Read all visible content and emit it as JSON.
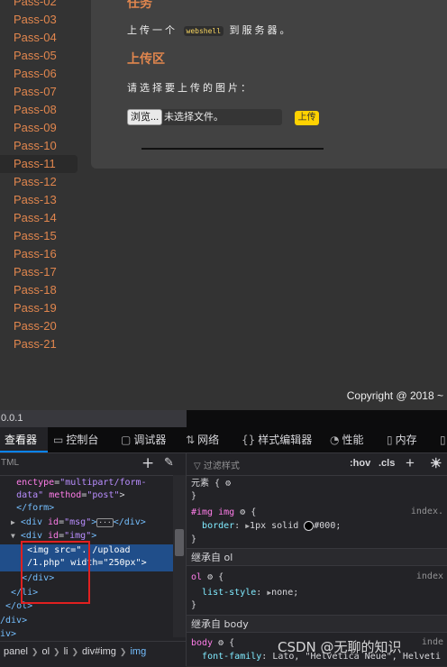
{
  "sidebar": {
    "items": [
      "Pass-02",
      "Pass-03",
      "Pass-04",
      "Pass-05",
      "Pass-06",
      "Pass-07",
      "Pass-08",
      "Pass-09",
      "Pass-10",
      "Pass-11",
      "Pass-12",
      "Pass-13",
      "Pass-14",
      "Pass-15",
      "Pass-16",
      "Pass-17",
      "Pass-18",
      "Pass-19",
      "Pass-20",
      "Pass-21"
    ],
    "active": "Pass-11"
  },
  "panel": {
    "task_heading": "任务",
    "task_prefix": "上传一个",
    "task_code": "webshell",
    "task_suffix": "到服务器。",
    "upload_heading": "上传区",
    "select_prompt": "请选择要上传的图片：",
    "browse_label": "浏览...",
    "file_status": "未选择文件。",
    "upload_label": "上传"
  },
  "footer": {
    "copyright": "Copyright @ 2018 ~"
  },
  "devtools": {
    "address": "0.0.1",
    "tabs": [
      {
        "icon": "inspector-icon",
        "label": "查看器"
      },
      {
        "icon": "console-icon",
        "label": "控制台"
      },
      {
        "icon": "debugger-icon",
        "label": "调试器"
      },
      {
        "icon": "network-icon",
        "label": "网络"
      },
      {
        "icon": "style-editor-icon",
        "label": "样式编辑器"
      },
      {
        "icon": "performance-icon",
        "label": "性能"
      },
      {
        "icon": "memory-icon",
        "label": "内存"
      }
    ],
    "markup_search_placeholder": "TML",
    "markup": {
      "l1_attr": "enctype",
      "l1_val": "\"multipart/form-",
      "l2_val": "data\"",
      "l2_attr": "method",
      "l2_val2": "\"post\"",
      "l3_tag": "</form>",
      "l4_tag_open": "<div",
      "l4_attr": "id",
      "l4_val": "\"msg\"",
      "l4_close": "</div>",
      "l5_tag_open": "<div",
      "l5_attr": "id",
      "l5_val": "\"img\"",
      "l6_tag": "<img",
      "l6_attr": "src",
      "l6_val": "\"../upload",
      "l7_val": "/1.php\"",
      "l7_attr": "width",
      "l7_val2": "\"250px\"",
      "l8_tag": "</div>",
      "l9_tag": "</li>",
      "l10_tag": "</ol>",
      "l11_tag": "/div>",
      "l12_tag": "iv>"
    },
    "breadcrumbs": [
      "panel",
      "ol",
      "li",
      "div#img",
      "img"
    ],
    "rules_filter_placeholder": "过滤样式",
    "rules_controls": {
      "hov": ":hov",
      "cls": ".cls"
    },
    "rules": {
      "element_label": "元素",
      "rule1_selector": "#img img",
      "rule1_source": "index.",
      "rule1_prop": "border",
      "rule1_value": "1px solid",
      "rule1_color": "#000",
      "inherit_ol": "继承自 ol",
      "rule2_selector": "ol",
      "rule2_source": "index",
      "rule2_prop": "list-style",
      "rule2_value": "none",
      "inherit_body": "继承自 body",
      "rule3_selector": "body",
      "rule3_source": "inde",
      "rule3_prop": "font-family",
      "rule3_value": "Lato, \"Helvetica Neue\", Helveti"
    },
    "watermark": "CSDN @无聊的知识"
  },
  "colors": {
    "accent": "#e1864e",
    "upload_button": "#ffd200",
    "selection": "#204e8a",
    "highlight_box": "#e02020"
  }
}
